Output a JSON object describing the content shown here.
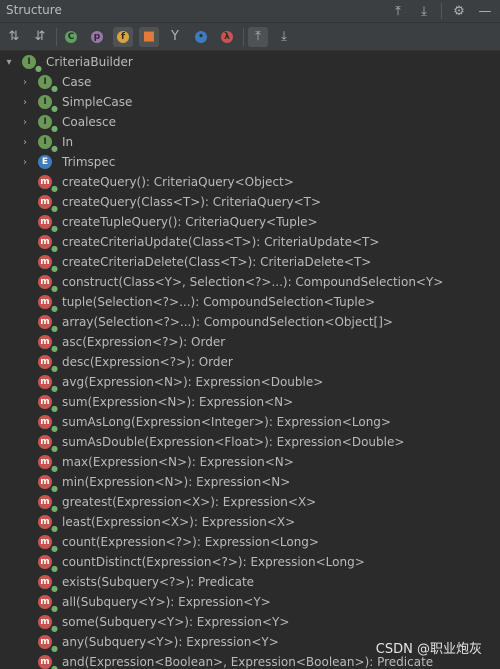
{
  "title": "Structure",
  "root": "CriteriaBuilder",
  "children": [
    {
      "label": "Case",
      "kind": "interface",
      "expand": true
    },
    {
      "label": "SimpleCase",
      "kind": "interface",
      "expand": true
    },
    {
      "label": "Coalesce",
      "kind": "interface",
      "expand": true
    },
    {
      "label": "In",
      "kind": "interface",
      "expand": true
    },
    {
      "label": "Trimspec",
      "kind": "enum",
      "expand": true
    },
    {
      "label": "createQuery(): CriteriaQuery<Object>",
      "kind": "method"
    },
    {
      "label": "createQuery(Class<T>): CriteriaQuery<T>",
      "kind": "method"
    },
    {
      "label": "createTupleQuery(): CriteriaQuery<Tuple>",
      "kind": "method"
    },
    {
      "label": "createCriteriaUpdate(Class<T>): CriteriaUpdate<T>",
      "kind": "method"
    },
    {
      "label": "createCriteriaDelete(Class<T>): CriteriaDelete<T>",
      "kind": "method"
    },
    {
      "label": "construct(Class<Y>, Selection<?>...): CompoundSelection<Y>",
      "kind": "method"
    },
    {
      "label": "tuple(Selection<?>...): CompoundSelection<Tuple>",
      "kind": "method"
    },
    {
      "label": "array(Selection<?>...): CompoundSelection<Object[]>",
      "kind": "method"
    },
    {
      "label": "asc(Expression<?>): Order",
      "kind": "method"
    },
    {
      "label": "desc(Expression<?>): Order",
      "kind": "method"
    },
    {
      "label": "avg(Expression<N>): Expression<Double>",
      "kind": "method"
    },
    {
      "label": "sum(Expression<N>): Expression<N>",
      "kind": "method"
    },
    {
      "label": "sumAsLong(Expression<Integer>): Expression<Long>",
      "kind": "method"
    },
    {
      "label": "sumAsDouble(Expression<Float>): Expression<Double>",
      "kind": "method"
    },
    {
      "label": "max(Expression<N>): Expression<N>",
      "kind": "method"
    },
    {
      "label": "min(Expression<N>): Expression<N>",
      "kind": "method"
    },
    {
      "label": "greatest(Expression<X>): Expression<X>",
      "kind": "method"
    },
    {
      "label": "least(Expression<X>): Expression<X>",
      "kind": "method"
    },
    {
      "label": "count(Expression<?>): Expression<Long>",
      "kind": "method"
    },
    {
      "label": "countDistinct(Expression<?>): Expression<Long>",
      "kind": "method"
    },
    {
      "label": "exists(Subquery<?>): Predicate",
      "kind": "method"
    },
    {
      "label": "all(Subquery<Y>): Expression<Y>",
      "kind": "method"
    },
    {
      "label": "some(Subquery<Y>): Expression<Y>",
      "kind": "method"
    },
    {
      "label": "any(Subquery<Y>): Expression<Y>",
      "kind": "method"
    },
    {
      "label": "and(Expression<Boolean>, Expression<Boolean>): Predicate",
      "kind": "method"
    }
  ],
  "watermark": "CSDN @职业炮灰"
}
